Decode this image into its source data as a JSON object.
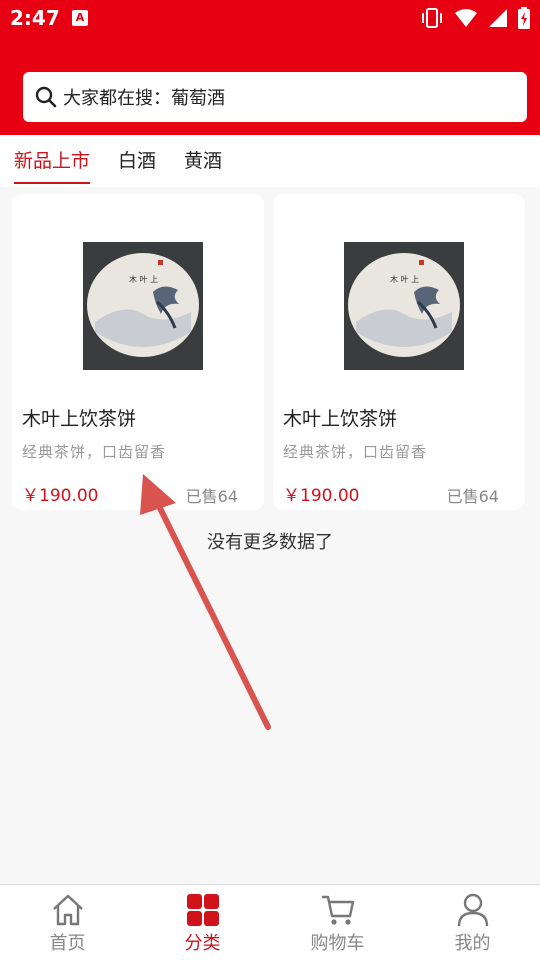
{
  "status_bar": {
    "time": "2:47",
    "badge": "A"
  },
  "search": {
    "text": "大家都在搜：葡萄酒"
  },
  "tabs": [
    {
      "label": "新品上市",
      "active": true
    },
    {
      "label": "白酒",
      "active": false
    },
    {
      "label": "黄酒",
      "active": false
    }
  ],
  "products": [
    {
      "name": "木叶上饮茶饼",
      "desc": "经典茶饼，口齿留香",
      "price": "￥190.00",
      "sold": "已售64"
    },
    {
      "name": "木叶上饮茶饼",
      "desc": "经典茶饼，口齿留香",
      "price": "￥190.00",
      "sold": "已售64"
    }
  ],
  "list_footer": "没有更多数据了",
  "bottom_nav": [
    {
      "label": "首页",
      "icon": "home-icon",
      "active": false
    },
    {
      "label": "分类",
      "icon": "category-grid-icon",
      "active": true
    },
    {
      "label": "购物车",
      "icon": "cart-icon",
      "active": false
    },
    {
      "label": "我的",
      "icon": "user-icon",
      "active": false
    }
  ],
  "colors": {
    "brand_red": "#e60012",
    "accent_red": "#d0121b"
  }
}
